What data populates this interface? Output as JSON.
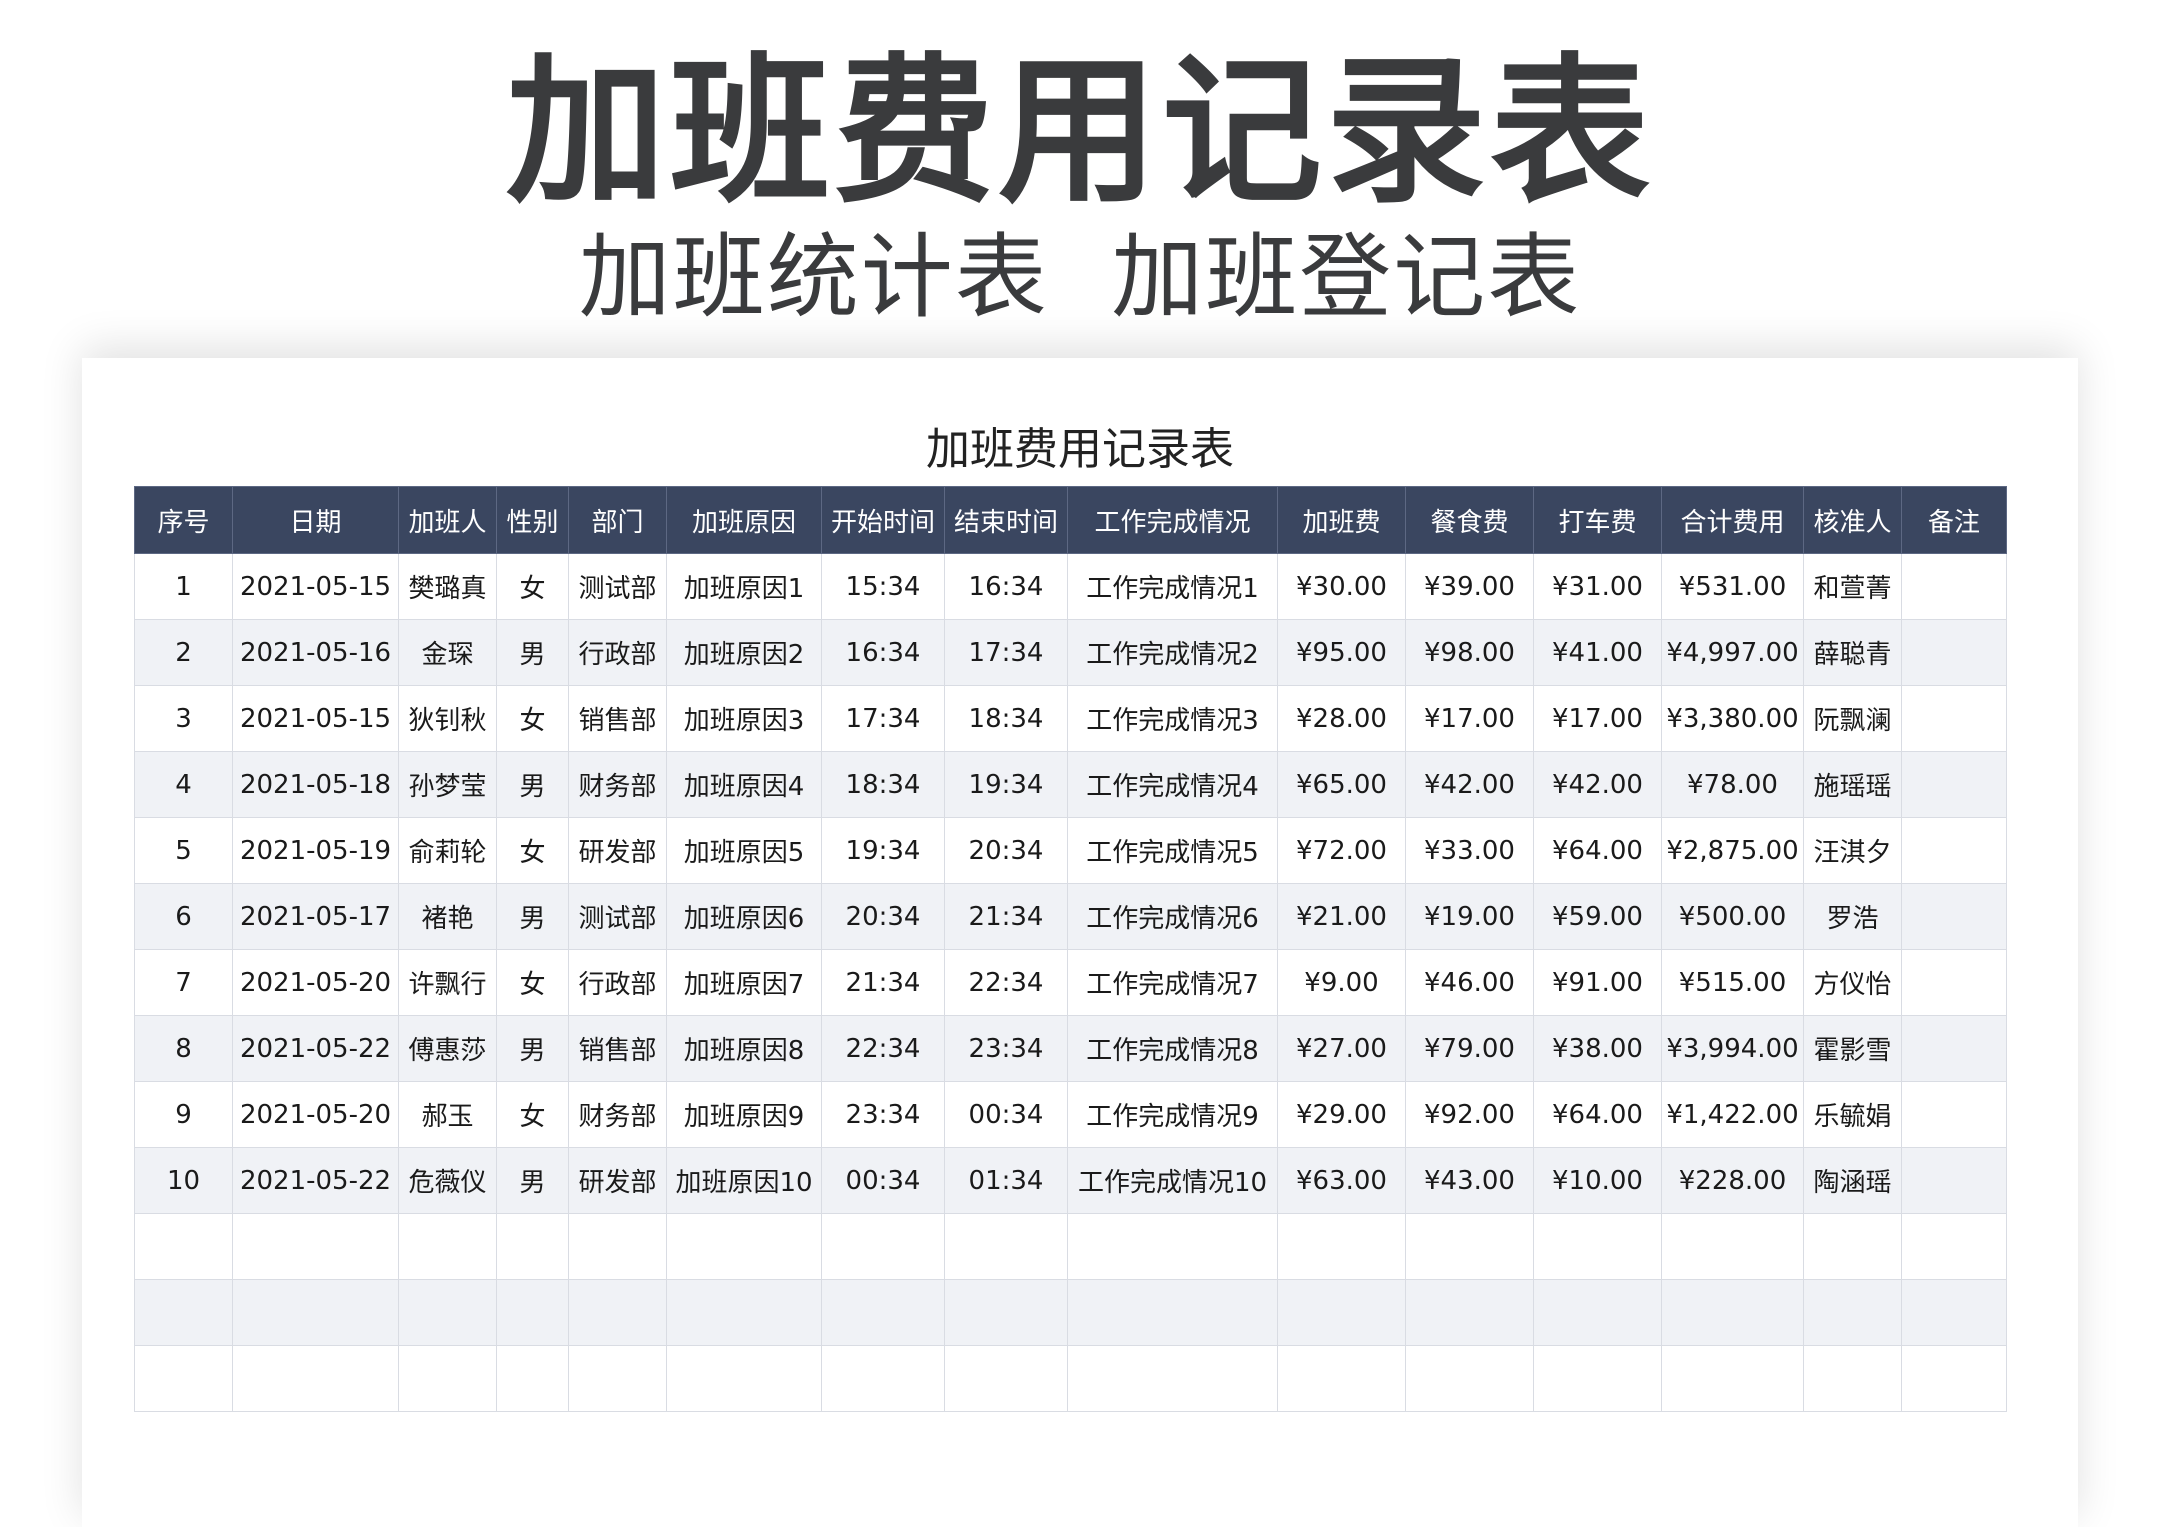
{
  "hero": {
    "title": "加班费用记录表",
    "subtitle": "加班统计表  加班登记表"
  },
  "sheet": {
    "title": "加班费用记录表",
    "columns": [
      "序号",
      "日期",
      "加班人",
      "性别",
      "部门",
      "加班原因",
      "开始时间",
      "结束时间",
      "工作完成情况",
      "加班费",
      "餐食费",
      "打车费",
      "合计费用",
      "核准人",
      "备注"
    ],
    "rows": [
      [
        "1",
        "2021-05-15",
        "樊璐真",
        "女",
        "测试部",
        "加班原因1",
        "15:34",
        "16:34",
        "工作完成情况1",
        "¥30.00",
        "¥39.00",
        "¥31.00",
        "¥531.00",
        "和萱菁",
        ""
      ],
      [
        "2",
        "2021-05-16",
        "金琛",
        "男",
        "行政部",
        "加班原因2",
        "16:34",
        "17:34",
        "工作完成情况2",
        "¥95.00",
        "¥98.00",
        "¥41.00",
        "¥4,997.00",
        "薛聪青",
        ""
      ],
      [
        "3",
        "2021-05-15",
        "狄钊秋",
        "女",
        "销售部",
        "加班原因3",
        "17:34",
        "18:34",
        "工作完成情况3",
        "¥28.00",
        "¥17.00",
        "¥17.00",
        "¥3,380.00",
        "阮飘澜",
        ""
      ],
      [
        "4",
        "2021-05-18",
        "孙梦莹",
        "男",
        "财务部",
        "加班原因4",
        "18:34",
        "19:34",
        "工作完成情况4",
        "¥65.00",
        "¥42.00",
        "¥42.00",
        "¥78.00",
        "施瑶瑶",
        ""
      ],
      [
        "5",
        "2021-05-19",
        "俞莉轮",
        "女",
        "研发部",
        "加班原因5",
        "19:34",
        "20:34",
        "工作完成情况5",
        "¥72.00",
        "¥33.00",
        "¥64.00",
        "¥2,875.00",
        "汪淇夕",
        ""
      ],
      [
        "6",
        "2021-05-17",
        "褚艳",
        "男",
        "测试部",
        "加班原因6",
        "20:34",
        "21:34",
        "工作完成情况6",
        "¥21.00",
        "¥19.00",
        "¥59.00",
        "¥500.00",
        "罗浩",
        ""
      ],
      [
        "7",
        "2021-05-20",
        "许飘行",
        "女",
        "行政部",
        "加班原因7",
        "21:34",
        "22:34",
        "工作完成情况7",
        "¥9.00",
        "¥46.00",
        "¥91.00",
        "¥515.00",
        "方仪怡",
        ""
      ],
      [
        "8",
        "2021-05-22",
        "傅惠莎",
        "男",
        "销售部",
        "加班原因8",
        "22:34",
        "23:34",
        "工作完成情况8",
        "¥27.00",
        "¥79.00",
        "¥38.00",
        "¥3,994.00",
        "霍影雪",
        ""
      ],
      [
        "9",
        "2021-05-20",
        "郝玉",
        "女",
        "财务部",
        "加班原因9",
        "23:34",
        "00:34",
        "工作完成情况9",
        "¥29.00",
        "¥92.00",
        "¥64.00",
        "¥1,422.00",
        "乐毓娟",
        ""
      ],
      [
        "10",
        "2021-05-22",
        "危薇仪",
        "男",
        "研发部",
        "加班原因10",
        "00:34",
        "01:34",
        "工作完成情况10",
        "¥63.00",
        "¥43.00",
        "¥10.00",
        "¥228.00",
        "陶涵瑶",
        ""
      ],
      [
        "",
        "",
        "",
        "",
        "",
        "",
        "",
        "",
        "",
        "",
        "",
        "",
        "",
        "",
        ""
      ],
      [
        "",
        "",
        "",
        "",
        "",
        "",
        "",
        "",
        "",
        "",
        "",
        "",
        "",
        "",
        ""
      ],
      [
        "",
        "",
        "",
        "",
        "",
        "",
        "",
        "",
        "",
        "",
        "",
        "",
        "",
        "",
        ""
      ]
    ]
  },
  "colors": {
    "header_bg": "#3a4660",
    "header_text": "#ffffff",
    "stripe_bg": "#f0f2f6",
    "title_text": "#3a3b3d"
  }
}
